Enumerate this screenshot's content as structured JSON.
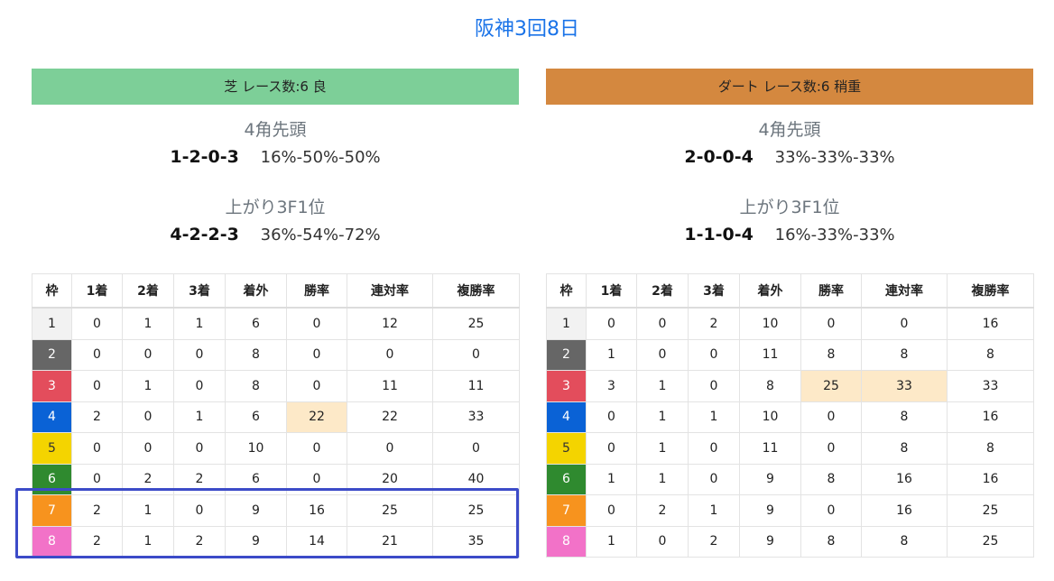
{
  "page_title": "阪神3回8日",
  "columns": [
    "枠",
    "1着",
    "2着",
    "3着",
    "着外",
    "勝率",
    "連対率",
    "複勝率"
  ],
  "waku_colors": {
    "1": {
      "bg": "#f2f2f2",
      "fg": "#222222"
    },
    "2": {
      "bg": "#666666",
      "fg": "#ffffff"
    },
    "3": {
      "bg": "#e34d5c",
      "fg": "#ffffff"
    },
    "4": {
      "bg": "#0a62d6",
      "fg": "#ffffff"
    },
    "5": {
      "bg": "#f4d400",
      "fg": "#333333"
    },
    "6": {
      "bg": "#2f8a2f",
      "fg": "#ffffff"
    },
    "7": {
      "bg": "#f7931e",
      "fg": "#ffffff"
    },
    "8": {
      "bg": "#f272c8",
      "fg": "#ffffff"
    }
  },
  "highlight_color": "#fde9c8",
  "turf": {
    "header": "芝 レース数:6  良",
    "header_color": "#7dcf98",
    "section1_label": "4角先頭",
    "section1_nums": "1-2-0-3",
    "section1_pcts": "16%-50%-50%",
    "section2_label": "上がり3F1位",
    "section2_nums": "4-2-2-3",
    "section2_pcts": "36%-54%-72%",
    "rows": [
      [
        "1",
        "0",
        "1",
        "1",
        "6",
        "0",
        "12",
        "25"
      ],
      [
        "2",
        "0",
        "0",
        "0",
        "8",
        "0",
        "0",
        "0"
      ],
      [
        "3",
        "0",
        "1",
        "0",
        "8",
        "0",
        "11",
        "11"
      ],
      [
        "4",
        "2",
        "0",
        "1",
        "6",
        "22",
        "22",
        "33"
      ],
      [
        "5",
        "0",
        "0",
        "0",
        "10",
        "0",
        "0",
        "0"
      ],
      [
        "6",
        "0",
        "2",
        "2",
        "6",
        "0",
        "20",
        "40"
      ],
      [
        "7",
        "2",
        "1",
        "0",
        "9",
        "16",
        "25",
        "25"
      ],
      [
        "8",
        "2",
        "1",
        "2",
        "9",
        "14",
        "21",
        "35"
      ]
    ],
    "highlighted_cells": [
      [
        3,
        5
      ]
    ]
  },
  "dirt": {
    "header": "ダート レース数:6  稍重",
    "header_color": "#d4883f",
    "section1_label": "4角先頭",
    "section1_nums": "2-0-0-4",
    "section1_pcts": "33%-33%-33%",
    "section2_label": "上がり3F1位",
    "section2_nums": "1-1-0-4",
    "section2_pcts": "16%-33%-33%",
    "rows": [
      [
        "1",
        "0",
        "0",
        "2",
        "10",
        "0",
        "0",
        "16"
      ],
      [
        "2",
        "1",
        "0",
        "0",
        "11",
        "8",
        "8",
        "8"
      ],
      [
        "3",
        "3",
        "1",
        "0",
        "8",
        "25",
        "33",
        "33"
      ],
      [
        "4",
        "0",
        "1",
        "1",
        "10",
        "0",
        "8",
        "16"
      ],
      [
        "5",
        "0",
        "1",
        "0",
        "11",
        "0",
        "8",
        "8"
      ],
      [
        "6",
        "1",
        "1",
        "0",
        "9",
        "8",
        "16",
        "16"
      ],
      [
        "7",
        "0",
        "2",
        "1",
        "9",
        "0",
        "16",
        "25"
      ],
      [
        "8",
        "1",
        "0",
        "2",
        "9",
        "8",
        "8",
        "25"
      ]
    ],
    "highlighted_cells": [
      [
        2,
        5
      ],
      [
        2,
        6
      ]
    ]
  },
  "annotation_box_color": "#3c4bc8"
}
